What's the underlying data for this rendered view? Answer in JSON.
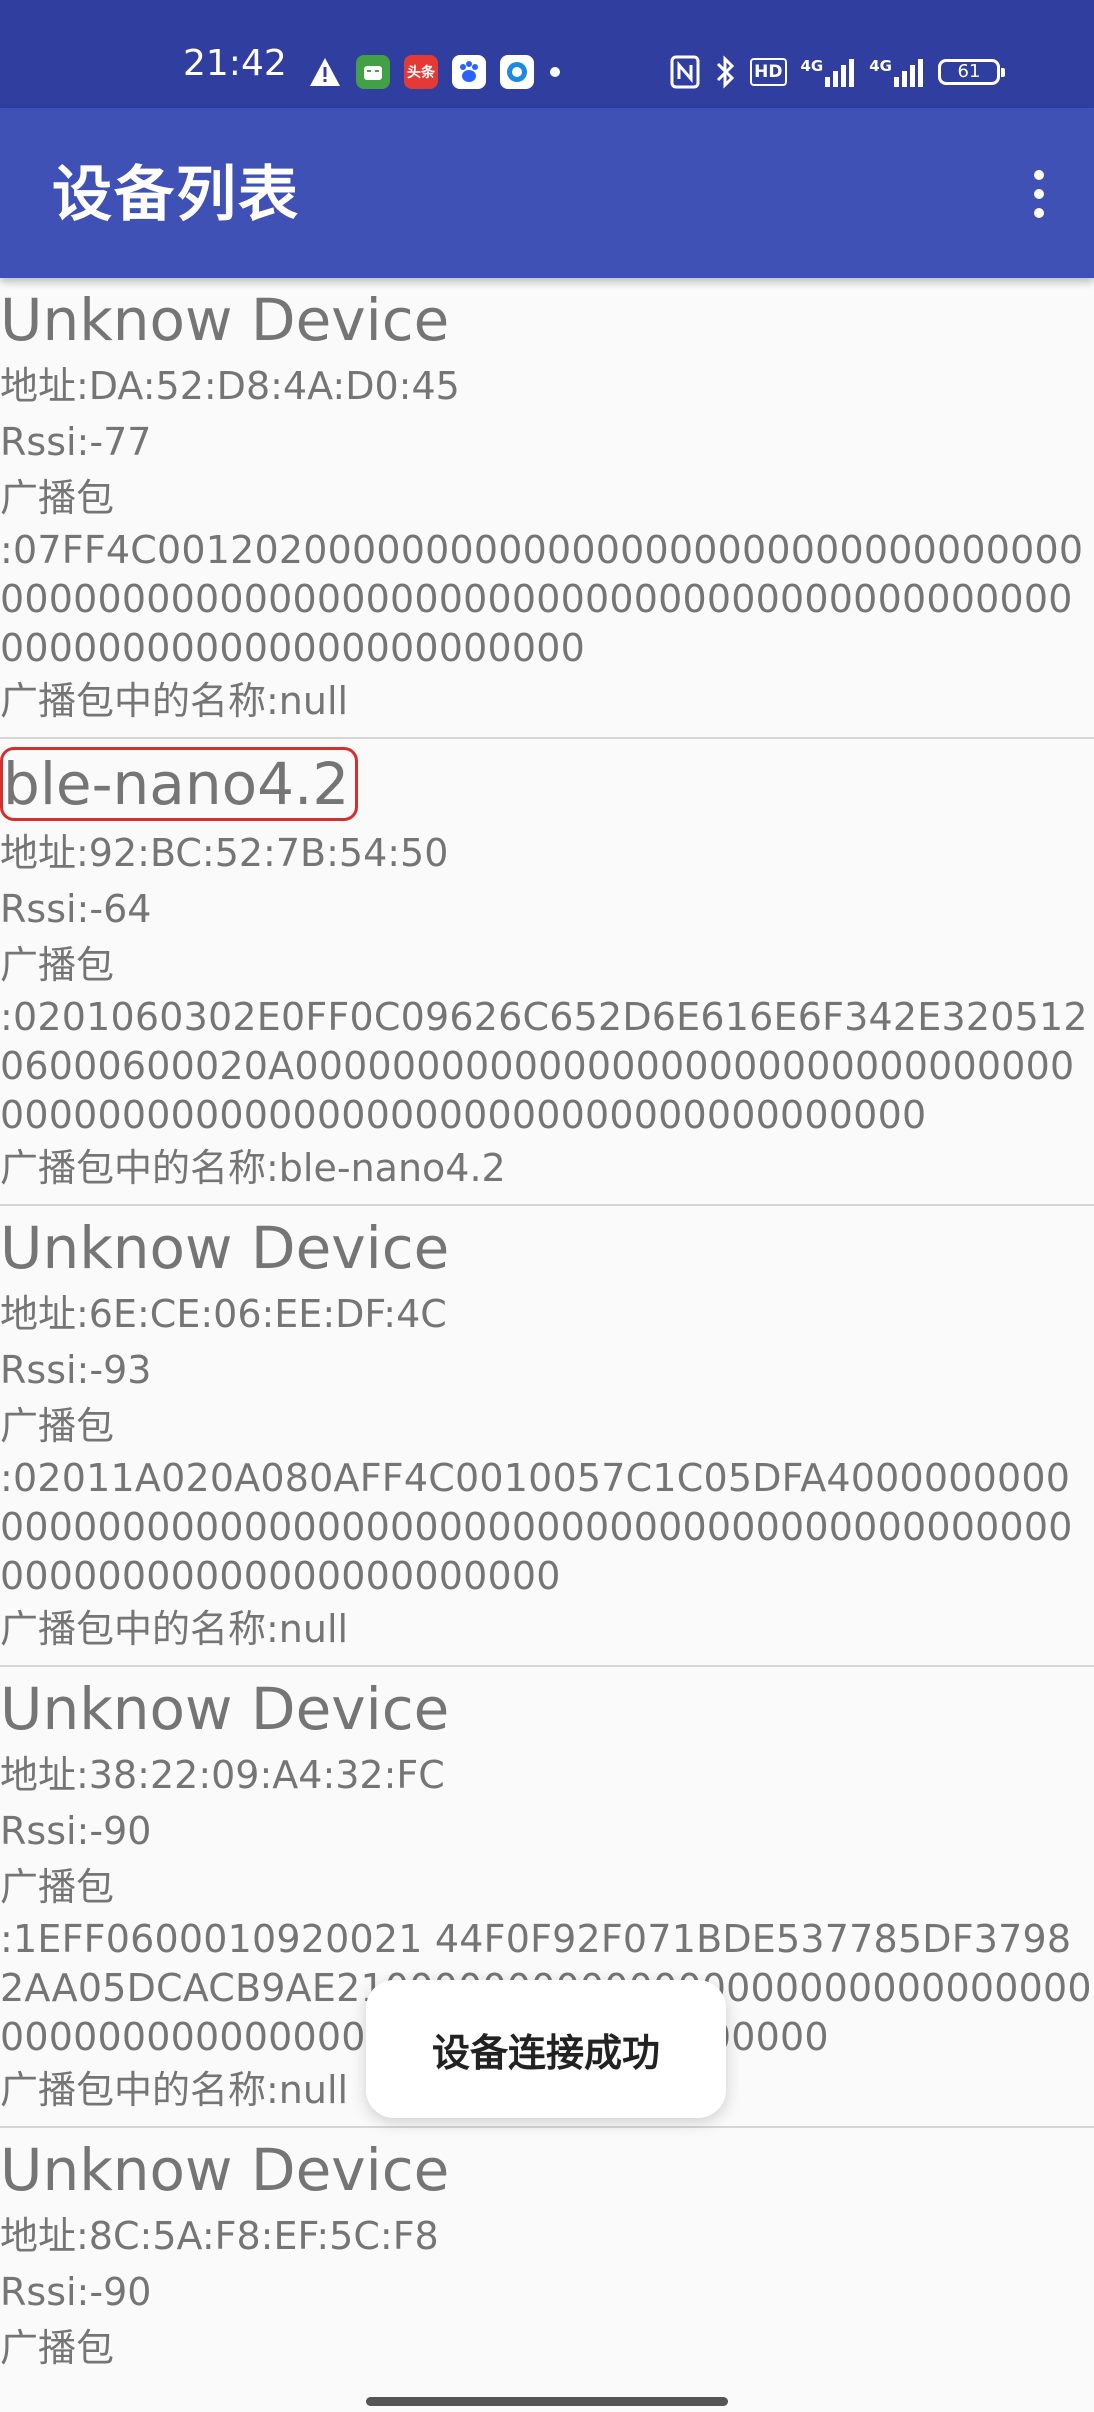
{
  "status_bar": {
    "time": "21:42",
    "app_icon_labels": [
      "头条"
    ],
    "network_labels": [
      "HD",
      "4G",
      "4G"
    ],
    "battery": "61"
  },
  "app_bar": {
    "title": "设备列表",
    "menu_icon": "more-vert-icon"
  },
  "devices": [
    {
      "name": "Unknow Device",
      "address": "地址:DA:52:D8:4A:D0:45",
      "rssi": "Rssi:-77",
      "adv_label": "广播包",
      "adv_data": ":07FF4C0012020000000000000000000000000000000000000000000000000000000000000000000000000000000000000000000000000000",
      "adv_name": "广播包中的名称:null",
      "highlighted": false
    },
    {
      "name": "ble-nano4.2",
      "address": "地址:92:BC:52:7B:54:50",
      "rssi": "Rssi:-64",
      "adv_label": "广播包",
      "adv_data": ":0201060302E0FF0C09626C652D6E616E6F342E32051206000600020A0000000000000000000000000000000000000000000000000000000000000000000000",
      "adv_name": "广播包中的名称:ble-nano4.2",
      "highlighted": true
    },
    {
      "name": "Unknow Device",
      "address": "地址:6E:CE:06:EE:DF:4C",
      "rssi": "Rssi:-93",
      "adv_label": "广播包",
      "adv_data": ":02011A020A080AFF4C0010057C1C05DFA40000000000000000000000000000000000000000000000000000000000000000000000000000",
      "adv_name": "广播包中的名称:null",
      "highlighted": false
    },
    {
      "name": "Unknow Device",
      "address": "地址:38:22:09:A4:32:FC",
      "rssi": "Rssi:-90",
      "adv_label": "广播包",
      "adv_data": ":1EFF0600010920021 44F0F92F071BDE537785DF37982AA05DCACB9AE21000000000000000000000000000000000000000000000000000000000000000",
      "adv_name": "广播包中的名称:null",
      "highlighted": false
    },
    {
      "name": "Unknow Device",
      "address": "地址:8C:5A:F8:EF:5C:F8",
      "rssi": "Rssi:-90",
      "adv_label": "广播包",
      "adv_data": "",
      "adv_name": "",
      "highlighted": false
    }
  ],
  "toast": {
    "message": "设备连接成功"
  }
}
